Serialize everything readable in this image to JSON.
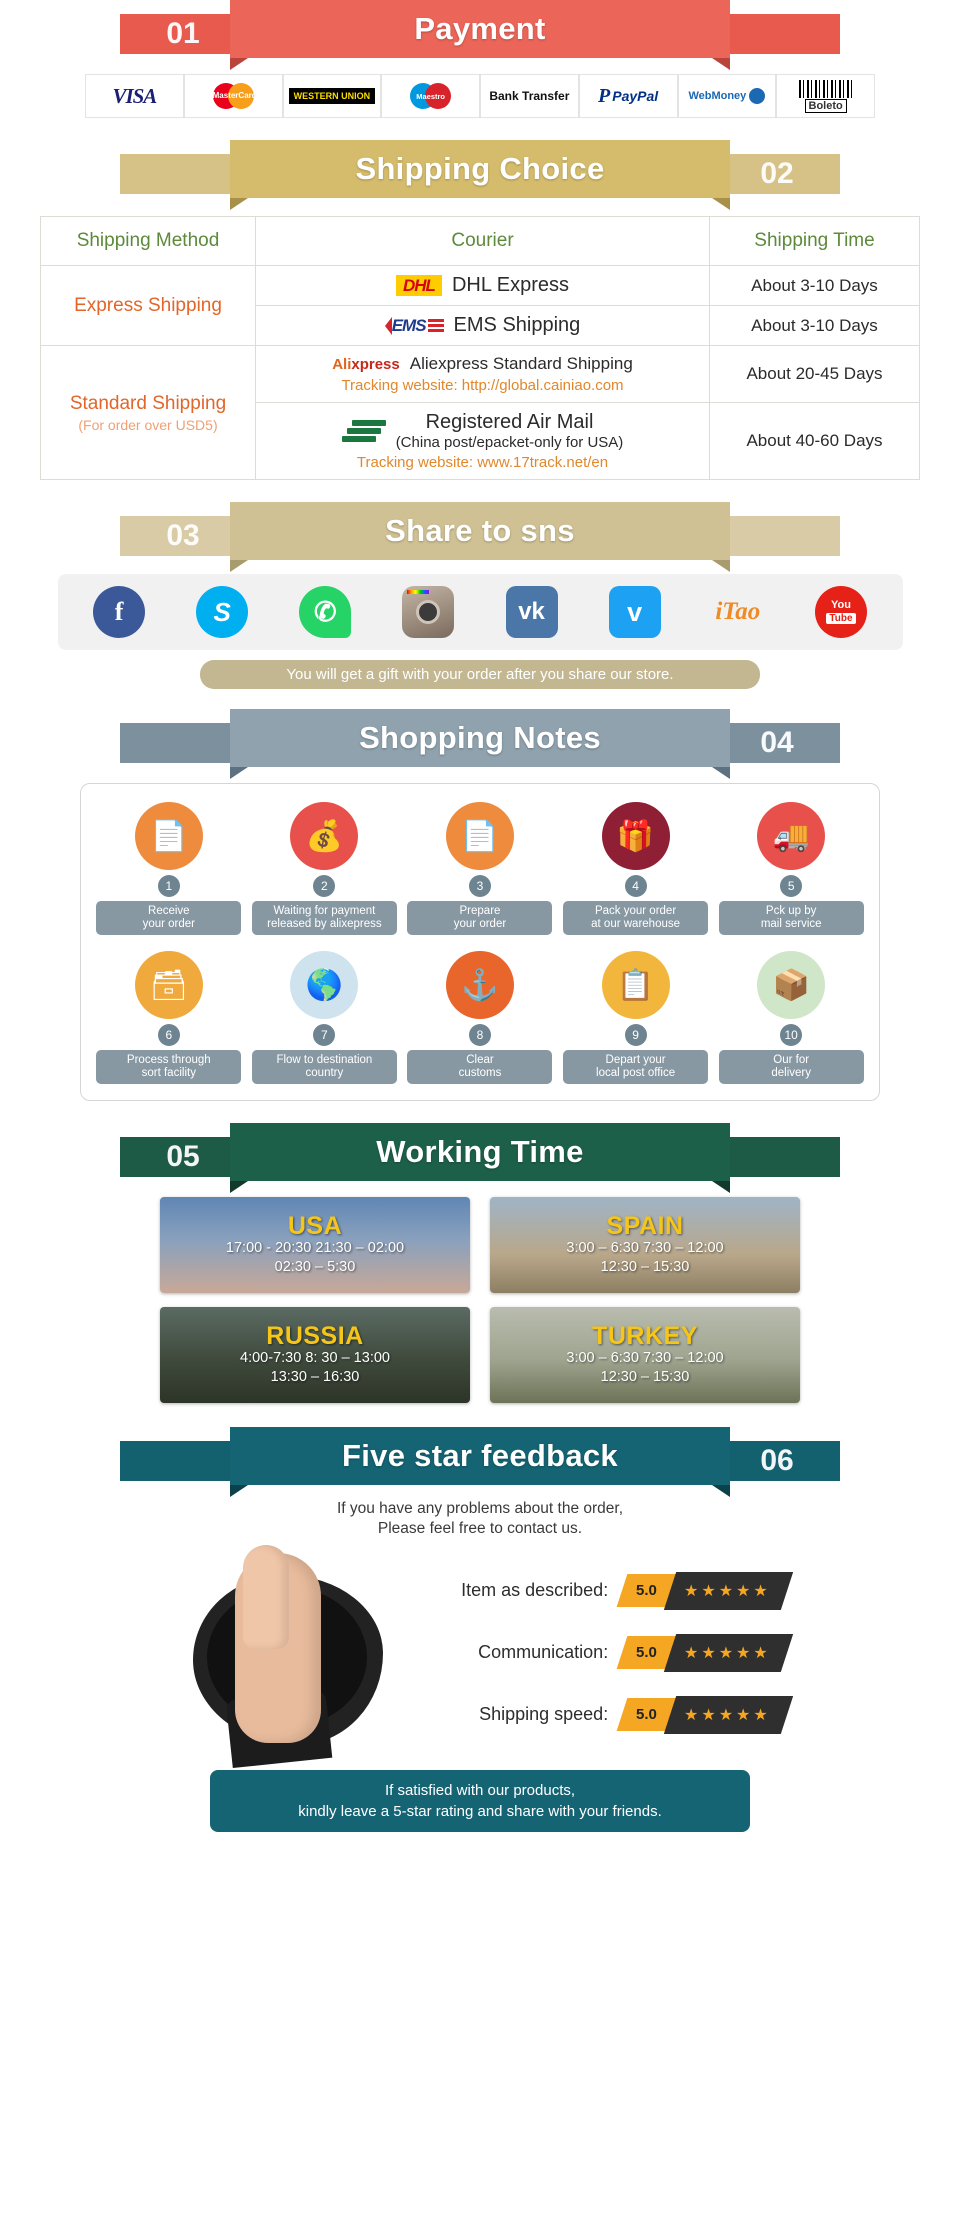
{
  "sections": {
    "payment": {
      "number": "01",
      "title": "Payment",
      "number_side": "left"
    },
    "shipping": {
      "number": "02",
      "title": "Shipping Choice",
      "number_side": "right"
    },
    "sns": {
      "number": "03",
      "title": "Share to sns",
      "number_side": "left"
    },
    "notes": {
      "number": "04",
      "title": "Shopping Notes",
      "number_side": "right"
    },
    "working": {
      "number": "05",
      "title": "Working Time",
      "number_side": "left"
    },
    "feedback": {
      "number": "06",
      "title": "Five star feedback",
      "number_side": "right"
    }
  },
  "payment_methods": [
    {
      "name": "visa",
      "label": "VISA"
    },
    {
      "name": "mastercard",
      "label": "MasterCard"
    },
    {
      "name": "western-union",
      "label": "WESTERN UNION"
    },
    {
      "name": "maestro",
      "label": "Maestro"
    },
    {
      "name": "bank-transfer",
      "label": "Bank Transfer"
    },
    {
      "name": "paypal",
      "label": "PayPal"
    },
    {
      "name": "webmoney",
      "label": "WebMoney"
    },
    {
      "name": "boleto",
      "label": "Boleto"
    }
  ],
  "shipping_table": {
    "headers": [
      "Shipping Method",
      "Courier",
      "Shipping Time"
    ],
    "groups": [
      {
        "method": "Express Shipping",
        "method_sub": "",
        "rows": [
          {
            "courier": "DHL Express",
            "courier_sub": "",
            "tracking": "",
            "time": "About 3-10 Days",
            "logo": "dhl"
          },
          {
            "courier": "EMS Shipping",
            "courier_sub": "",
            "tracking": "",
            "time": "About 3-10 Days",
            "logo": "ems"
          }
        ]
      },
      {
        "method": "Standard Shipping",
        "method_sub": "(For order over USD5)",
        "rows": [
          {
            "courier": "Aliexpress Standard Shipping",
            "courier_sub": "",
            "tracking": "Tracking website: http://global.cainiao.com",
            "time": "About 20-45 Days",
            "logo": "aliexpress"
          },
          {
            "courier": "Registered Air Mail",
            "courier_sub": "(China post/epacket-only for USA)",
            "tracking": "Tracking website: www.17track.net/en",
            "time": "About 40-60 Days",
            "logo": "chinapost"
          }
        ]
      }
    ]
  },
  "sns": {
    "icons": [
      {
        "name": "facebook-icon",
        "glyph": "f"
      },
      {
        "name": "skype-icon",
        "glyph": "S"
      },
      {
        "name": "whatsapp-icon",
        "glyph": "✆"
      },
      {
        "name": "instagram-icon",
        "glyph": ""
      },
      {
        "name": "vk-icon",
        "glyph": "vk"
      },
      {
        "name": "twitter-icon",
        "glyph": "ᴠ"
      },
      {
        "name": "itao-icon",
        "glyph": "iTao"
      },
      {
        "name": "youtube-icon",
        "glyph": "You",
        "glyph2": "Tube"
      }
    ],
    "note": "You will get a gift with your order after you share our store."
  },
  "shopping_notes": [
    {
      "num": "1",
      "label": "Receive\nyour order",
      "icon": "document-icon",
      "color": "#ef8b3c"
    },
    {
      "num": "2",
      "label": "Waiting for payment\nreleased by alixepress",
      "icon": "money-bag-icon",
      "color": "#e8514b"
    },
    {
      "num": "3",
      "label": "Prepare\nyour order",
      "icon": "document-icon",
      "color": "#ef8b3c"
    },
    {
      "num": "4",
      "label": "Pack your order\nat our warehouse",
      "icon": "gift-box-icon",
      "color": "#8e1f35"
    },
    {
      "num": "5",
      "label": "Pck up by\nmail service",
      "icon": "mail-truck-icon",
      "color": "#e8514b"
    },
    {
      "num": "6",
      "label": "Process through\nsort facility",
      "icon": "stamp-icon",
      "color": "#f0a93c"
    },
    {
      "num": "7",
      "label": "Flow to destination\ncountry",
      "icon": "globe-icon",
      "color": "#cfe3ef"
    },
    {
      "num": "8",
      "label": "Clear\ncustoms",
      "icon": "anchor-icon",
      "color": "#e8662b"
    },
    {
      "num": "9",
      "label": "Depart your\nlocal post office",
      "icon": "clipboard-icon",
      "color": "#f2b63c"
    },
    {
      "num": "10",
      "label": "Our for\ndelivery",
      "icon": "package-icon",
      "color": "#cfe6c8"
    }
  ],
  "working_time": [
    {
      "country": "USA",
      "line1": "17:00  -  20:30   21:30  –  02:00",
      "line2": "02:30  –  5:30"
    },
    {
      "country": "SPAIN",
      "line1": "3:00  –  6:30    7:30  –  12:00",
      "line2": "12:30  –  15:30"
    },
    {
      "country": "RUSSIA",
      "line1": "4:00-7:30   8: 30  –  13:00",
      "line2": "13:30  –  16:30"
    },
    {
      "country": "TURKEY",
      "line1": "3:00  –  6:30   7:30  –  12:00",
      "line2": "12:30  –  15:30"
    }
  ],
  "feedback": {
    "note_line1": "If you have any problems about the order,",
    "note_line2": "Please feel free to contact us.",
    "ratings": [
      {
        "label": "Item as described:",
        "score": "5.0",
        "stars": "★★★★★"
      },
      {
        "label": "Communication:",
        "score": "5.0",
        "stars": "★★★★★"
      },
      {
        "label": "Shipping speed:",
        "score": "5.0",
        "stars": "★★★★★"
      }
    ],
    "footer_line1": "If satisfied with our products,",
    "footer_line2": "kindly leave a 5-star rating and share with your friends."
  }
}
